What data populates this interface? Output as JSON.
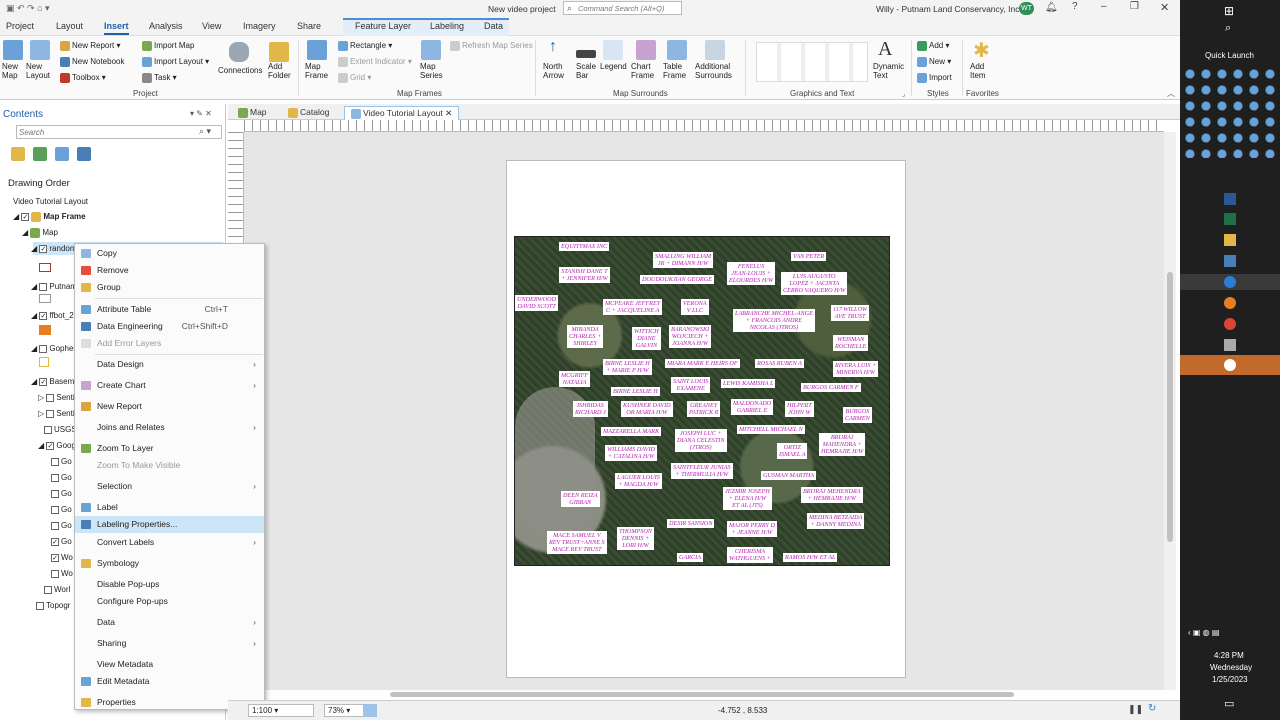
{
  "window": {
    "title": "New video project",
    "command_search_placeholder": "Command Search (Alt+Q)",
    "user": "Willy - Putnam Land Conservancy, Inc.",
    "user_initials": "WT"
  },
  "menu_tabs": [
    "Project",
    "Layout",
    "Insert",
    "Analysis",
    "View",
    "Imagery",
    "Share"
  ],
  "contextual_tabs": {
    "group": "Feature Layer",
    "labeling": "Labeling",
    "data": "Data"
  },
  "ribbon": {
    "new_map": "New\nMap",
    "new_layout": "New\nLayout",
    "new_report": "New Report",
    "new_notebook": "New Notebook",
    "toolbox": "Toolbox",
    "import_map": "Import Map",
    "import_layout": "Import Layout",
    "task": "Task",
    "connections": "Connections",
    "add_folder": "Add\nFolder",
    "project_group": "Project",
    "map_frame": "Map\nFrame",
    "rectangle": "Rectangle",
    "extent_indicator": "Extent Indicator",
    "grid": "Grid",
    "map_series": "Map\nSeries",
    "refresh_map_series": "Refresh Map Series",
    "map_frames_group": "Map Frames",
    "north_arrow": "North\nArrow",
    "scale_bar": "Scale\nBar",
    "legend": "Legend",
    "chart_frame": "Chart\nFrame",
    "table_frame": "Table\nFrame",
    "additional_surrounds": "Additional\nSurrounds",
    "map_surrounds_group": "Map Surrounds",
    "graphics_text_group": "Graphics and Text",
    "dynamic_text": "Dynamic\nText",
    "add": "Add",
    "new": "New",
    "import": "Import",
    "styles_group": "Styles",
    "add_item": "Add\nItem",
    "favorites_group": "Favorites"
  },
  "contents": {
    "title": "Contents",
    "search_placeholder": "Search",
    "drawing_order": "Drawing Order",
    "layout_name": "Video Tutorial Layout",
    "map_frame": "Map Frame",
    "map": "Map",
    "layers": [
      "random",
      "Putnam",
      "ffbot_2",
      "Gopher",
      "Basem",
      "Senti",
      "Senti",
      "USGS",
      "Goog",
      "Go",
      "Go",
      "Go",
      "Go",
      "Go",
      "Go",
      "Wo",
      "Wo",
      "Worl",
      "Topogr"
    ]
  },
  "doc_tabs": [
    "Map",
    "Catalog",
    "Video Tutorial Layout"
  ],
  "context_menu": {
    "items": [
      {
        "label": "Copy"
      },
      {
        "label": "Remove"
      },
      {
        "label": "Group"
      },
      {
        "label": "Attribute Table",
        "shortcut": "Ctrl+T"
      },
      {
        "label": "Data Engineering",
        "shortcut": "Ctrl+Shift+D"
      },
      {
        "label": "Add Error Layers"
      },
      {
        "label": "Data Design"
      },
      {
        "label": "Create Chart"
      },
      {
        "label": "New Report"
      },
      {
        "label": "Joins and Relates"
      },
      {
        "label": "Zoom To Layer"
      },
      {
        "label": "Zoom To Make Visible"
      },
      {
        "label": "Selection"
      },
      {
        "label": "Label"
      },
      {
        "label": "Labeling Properties..."
      },
      {
        "label": "Convert Labels"
      },
      {
        "label": "Symbology"
      },
      {
        "label": "Disable Pop-ups"
      },
      {
        "label": "Configure Pop-ups"
      },
      {
        "label": "Data"
      },
      {
        "label": "Sharing"
      },
      {
        "label": "View Metadata"
      },
      {
        "label": "Edit Metadata"
      },
      {
        "label": "Properties"
      }
    ]
  },
  "map_labels": [
    "EQUITYMAX INC",
    "SMALLING WILLIAM\nJR + DIMANN H/W",
    "VAN PETER",
    "STANISH DANE T\n+ JENNIFER H/W",
    "FENELUS\nJEAN-LOUIS +\nELOURDES H/W",
    "DOUDOUKJIAN GEORGE",
    "LUIS AUGUSTO\nLOPEZ + JACINTA\nCERRO VAQUERO H/W",
    "UNDERWOOD\nDAVID SCOTT",
    "MCPEAKE JEFFREY\nC + JACQUELINE A",
    "VERONA\nV LLC",
    "LABRANCHE MICHEL-ANGE\n+ FRANCOIS ANDRE\nNICOLAS (JTROS)",
    "117 WILLOW\nAVE TRUST",
    "MIRANDA\nCHARLES +\nSHIRLEY",
    "WITTICH\nDIANE\nGALVIN",
    "BARANOWSKI\nWOJCIECH +\nJOANNA H/W",
    "WEISMAN\nROCHELLE",
    "BIRNE LESLIE H\n+ MARIE P H/W",
    "MIARA MARK E HEIRS OF",
    "ROSAS RUBEN A",
    "RIVERA LUIS +\nMINERVA H/W",
    "MCGRIFF\nNATALIA",
    "SAINT LOUIS\nEXAMENE",
    "LEWIS KAMISHA L",
    "BURGOS CARMEN F",
    "BIRNE LESLIE H",
    "ISHRIDAS\nRICHARD J",
    "KUSHNER DAVID\nOR MARIA H/W",
    "GREANEY\nPATRICK R",
    "MALDONADO\nGABRIEL E",
    "HILPERT\nJOHN W",
    "BURGOS\nCARMEN",
    "MAZZARELLA MARK",
    "JOSEPH LUC +\nDIANA CELESTIN\n(JTROS)",
    "MITCHELL MICHAEL N",
    "BRIJRAJ\nMAHENDRA +\nHEMRAJIE H/W",
    "WILLIAMS DAVID\n+ CATALINA H/W",
    "ORTIZ\nISMAEL A",
    "SAINTFLEUR JUNIAS\n+ THERMULIA H/W",
    "GUSMAN MARTHA",
    "LAGUER LOUIS\n+ MAGDA H/W",
    "JEZMIR JOSEPH\n+ ELENA H/W\nET AL (JTS)",
    "BRIJRAJ MEHENDRA\n+ HEMRAJIE H/W",
    "DEEN REIZA\nGIBRAN",
    "DESIR SANSION",
    "MAJOR PERRY D\n+ JEANNE H/W",
    "MEDINA BETZAIDA\n+ DANNY MEDINA",
    "MACE SAMUEL V\nREV TRUST+ANNE S\nMACE REV TRUST",
    "THOMPSON\nDENNIS +\nLORI H/W",
    "CHERISMA\nWATHGUENS +",
    "GARCIA",
    "RAMOS H/W ET AL"
  ],
  "status": {
    "scale": "1:100",
    "zoom": "73%",
    "coordinates": "-4.752 , 8.533"
  },
  "taskbar": {
    "quick_launch": "Quick Launch",
    "time": "4:28 PM",
    "day": "Wednesday",
    "date": "1/25/2023"
  }
}
